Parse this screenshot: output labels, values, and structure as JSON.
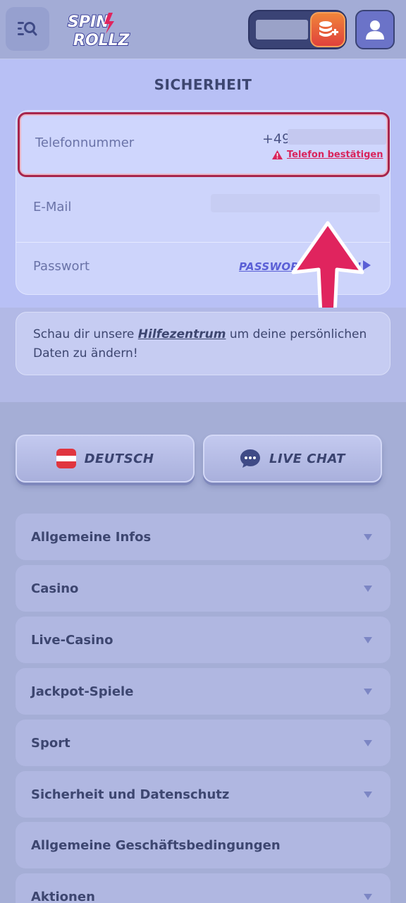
{
  "header": {
    "logo_line1": "SPIN",
    "logo_line2": "ROLLZ",
    "icons": [
      "search-menu-icon",
      "coins-plus-icon",
      "user-icon"
    ]
  },
  "security": {
    "title": "SICHERHEIT",
    "phone_label": "Telefonnummer",
    "phone_prefix": "+49",
    "verify_phone_link": "Telefon bestätigen",
    "email_label": "E-Mail",
    "password_label": "Passwort",
    "change_password_link": "PASSWORT ÄNDERN"
  },
  "info": {
    "text_before": "Schau dir unsere ",
    "link": "Hilfezentrum",
    "text_after": " um deine persönlichen Daten zu ändern!"
  },
  "buttons": {
    "language": "DEUTSCH",
    "live_chat": "LIVE CHAT"
  },
  "accordion": [
    {
      "label": "Allgemeine Infos",
      "expandable": true
    },
    {
      "label": "Casino",
      "expandable": true
    },
    {
      "label": "Live-Casino",
      "expandable": true
    },
    {
      "label": "Jackpot-Spiele",
      "expandable": true
    },
    {
      "label": "Sport",
      "expandable": true
    },
    {
      "label": "Sicherheit und Datenschutz",
      "expandable": true
    },
    {
      "label": "Allgemeine Geschäftsbedingungen",
      "expandable": false
    },
    {
      "label": "Aktionen",
      "expandable": true
    }
  ],
  "colors": {
    "accent_warning": "#d9245c",
    "link_blue": "#5a5fd6",
    "annotation_arrow": "#e0245e"
  }
}
